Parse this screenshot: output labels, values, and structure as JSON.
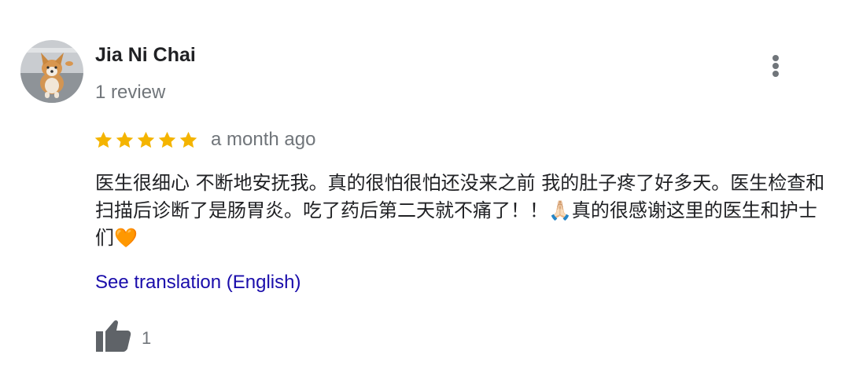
{
  "review": {
    "reviewer_name": "Jia Ni Chai",
    "review_count": "1 review",
    "rating": 5,
    "rating_max": 5,
    "time": "a month ago",
    "text": "医生很细心 不断地安抚我。真的很怕很怕还没来之前 我的肚子疼了好多天。医生检查和扫描后诊断了是肠胃炎。吃了药后第二天就不痛了！！🙏🏻真的很感谢这里的医生和护士们🧡",
    "translate_link": "See translation (English)",
    "like_count": "1"
  },
  "icons": {
    "avatar": "corgi-photo",
    "more": "more-vertical-icon",
    "star": "star-icon",
    "like": "thumbs-up-icon"
  },
  "colors": {
    "star": "#f4b400",
    "link": "#1a0dab",
    "secondary_text": "#70757a",
    "primary_text": "#202124",
    "icon": "#5f6368"
  }
}
